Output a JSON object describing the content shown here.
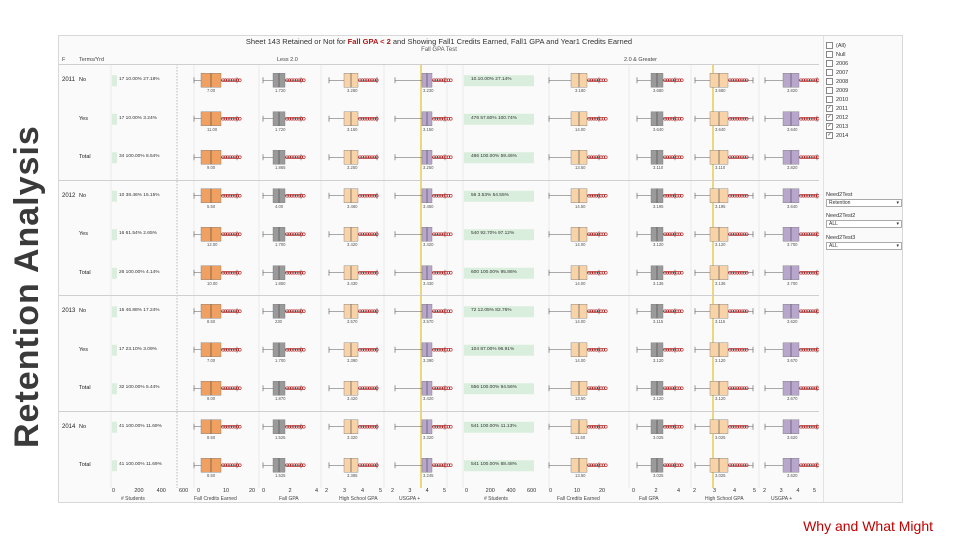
{
  "slide": {
    "side_title": "Retention Analysis",
    "footer": "Why and What Might"
  },
  "sheet": {
    "title_prefix": "Sheet 143 Retained or Not for ",
    "title_highlight": "Fall GPA < 2",
    "title_suffix": " and Showing Fall1 Credits Earned, Fall1 GPA and Year1 Credits Earned",
    "subtitle": "Fall GPA Test",
    "col_header_left": "F",
    "col_header_term": "Terms/Yrd",
    "col_header_less": "Less 2.0",
    "col_header_greater": "2.0 & Greater"
  },
  "rows": [
    {
      "year": "2011",
      "label": "No",
      "left": "17 10.00% 27.18%",
      "right": "10.10.00% 27.14%",
      "vals": [
        "7.00",
        "1.720",
        "3.280",
        "3.230",
        "3.180",
        "3.680",
        "3.820"
      ]
    },
    {
      "year": "",
      "label": "Yes",
      "left": "17 10.00% 3.24%",
      "right": "476 57.60% 100.74%",
      "vals": [
        "11.00",
        "1.720",
        "3.150",
        "3.150",
        "14.00",
        "3.640",
        "3.640"
      ]
    },
    {
      "year": "",
      "label": "Total",
      "left": "34 100.00% 8.54%",
      "right": "486 100.00% 59.46%",
      "vals": [
        "9.00",
        "1.865",
        "3.250",
        "3.250",
        "13.50",
        "3.110",
        "3.820"
      ]
    },
    {
      "year": "2012",
      "label": "No",
      "left": "10 38.46% 15.15%",
      "right": "56 3.53% 54.55%",
      "vals": [
        "5.50",
        "4.00",
        "3.460",
        "3.450",
        "14.50",
        "3.195",
        "3.640"
      ]
    },
    {
      "year": "",
      "label": "Yes",
      "left": "16 61.54% 2.65%",
      "right": "540 92.70% 97.12%",
      "vals": [
        "12.00",
        "1.700",
        "3.420",
        "3.420",
        "14.00",
        "3.120",
        "3.700"
      ]
    },
    {
      "year": "",
      "label": "Total",
      "left": "26 100.00% 4.14%",
      "right": "600 100.00% 95.86%",
      "vals": [
        "10.00",
        "1.850",
        "3.430",
        "3.430",
        "14.00",
        "3.136",
        "3.700"
      ]
    },
    {
      "year": "2013",
      "label": "No",
      "left": "15 46.88% 17.24%",
      "right": "72 12.05% 82.76%",
      "vals": [
        "8.50",
        "230",
        "3.570",
        "3.570",
        "14.00",
        "3.115",
        "3.620"
      ]
    },
    {
      "year": "",
      "label": "Yes",
      "left": "17 23.10% 3.09%",
      "right": "104 87.00% 96.91%",
      "vals": [
        "7.00",
        "1.700",
        "3.390",
        "3.390",
        "14.00",
        "3.120",
        "3.670"
      ]
    },
    {
      "year": "",
      "label": "Total",
      "left": "32 100.00% 5.44%",
      "right": "556 100.00% 94.56%",
      "vals": [
        "9.00",
        "1.870",
        "3.420",
        "3.420",
        "13.50",
        "3.120",
        "3.670"
      ]
    },
    {
      "year": "2014",
      "label": "No",
      "left": "41 100.00% 11.69%",
      "right": "541 100.00% 11.13%",
      "vals": [
        "8.50",
        "1.525",
        "3.320",
        "3.320",
        "11.50",
        "3.025",
        "3.620"
      ]
    },
    {
      "year": "",
      "label": "Total",
      "left": "41 100.00% 11.69%",
      "right": "541 100.00% 88.48%",
      "vals": [
        "8.50",
        "1.525",
        "3.385",
        "3.245",
        "13.50",
        "3.025",
        "3.620"
      ]
    }
  ],
  "axis": {
    "ticks_students_left": [
      "0",
      "200",
      "400",
      "600"
    ],
    "ticks_credits_left": [
      "0",
      "10",
      "20"
    ],
    "ticks_gpa_left": [
      "0",
      "2",
      "4"
    ],
    "ticks_hs_left": [
      "2",
      "3",
      "4",
      "5"
    ],
    "ticks_usgpa_left": [
      "2",
      "3",
      "4",
      "5"
    ],
    "ticks_students_right": [
      "0",
      "200",
      "400",
      "600"
    ],
    "ticks_credits_right": [
      "0",
      "10",
      "20"
    ],
    "ticks_gpa_right": [
      "0",
      "2",
      "4"
    ],
    "ticks_hs_right": [
      "2",
      "3",
      "4",
      "5"
    ],
    "ticks_usgpa_right": [
      "2",
      "3",
      "4",
      "5"
    ],
    "labels_left": [
      "# Students",
      "Fall Credits Earned",
      "Fall GPA",
      "High School GPA",
      "USGPA +"
    ],
    "labels_right": [
      "# Students",
      "Fall Credits Earned",
      "Fall GPA",
      "High School GPA",
      "USGPA +"
    ]
  },
  "sidebar": {
    "years": [
      {
        "label": "(All)",
        "checked": false
      },
      {
        "label": "Null",
        "checked": false
      },
      {
        "label": "2006",
        "checked": false
      },
      {
        "label": "2007",
        "checked": false
      },
      {
        "label": "2008",
        "checked": false
      },
      {
        "label": "2009",
        "checked": false
      },
      {
        "label": "2010",
        "checked": false
      },
      {
        "label": "2011",
        "checked": true
      },
      {
        "label": "2012",
        "checked": true
      },
      {
        "label": "2013",
        "checked": true
      },
      {
        "label": "2014",
        "checked": true
      }
    ],
    "filter1_title": "Need2Test",
    "filter1_value": "Retention",
    "filter2_title": "Need2Test2",
    "filter2_value": "ALL",
    "filter3_title": "Need2Test3",
    "filter3_value": "ALL"
  },
  "colors": {
    "orange": "#f0a060",
    "orange_light": "#f8d3a8",
    "gray": "#9a9a9a",
    "purple": "#b8a6cc",
    "green": "#d9eedd",
    "red_dot": "#b01818",
    "yellow_line": "#d8b700"
  }
}
